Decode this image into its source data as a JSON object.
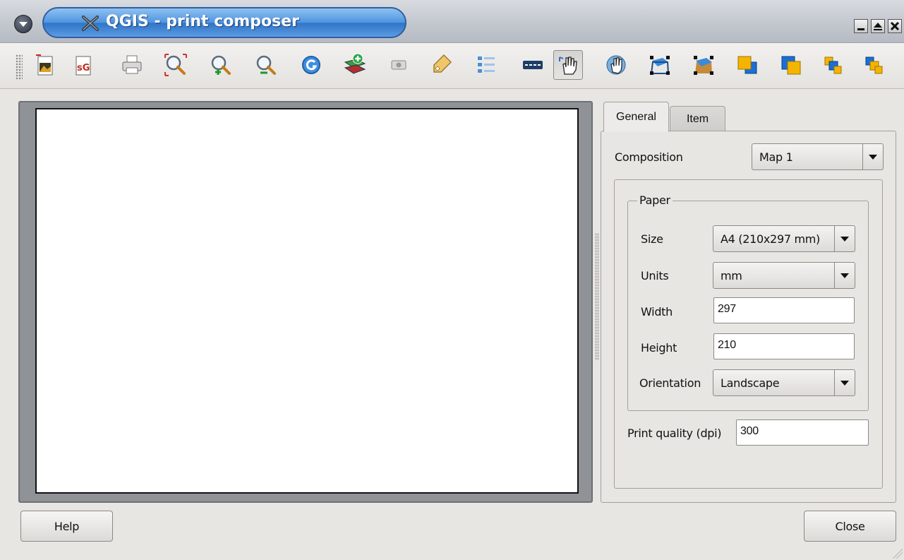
{
  "window": {
    "title": "QGIS - print composer"
  },
  "toolbar": {
    "buttons": [
      {
        "icon": "export-image-icon",
        "active": false
      },
      {
        "icon": "export-svg-icon",
        "active": false
      },
      {
        "icon": "print-icon",
        "active": false
      },
      {
        "icon": "zoom-full-icon",
        "active": false
      },
      {
        "icon": "zoom-in-icon",
        "active": false
      },
      {
        "icon": "zoom-out-icon",
        "active": false
      },
      {
        "icon": "refresh-icon",
        "active": false
      },
      {
        "icon": "add-map-icon",
        "active": false
      },
      {
        "icon": "add-image-icon",
        "active": false
      },
      {
        "icon": "add-label-icon",
        "active": false
      },
      {
        "icon": "add-legend-icon",
        "active": false
      },
      {
        "icon": "add-scalebar-icon",
        "active": false
      },
      {
        "icon": "select-move-icon",
        "active": true
      },
      {
        "icon": "move-content-icon",
        "active": false
      },
      {
        "icon": "group-icon",
        "active": false
      },
      {
        "icon": "ungroup-icon",
        "active": false
      },
      {
        "icon": "raise-icon",
        "active": false
      },
      {
        "icon": "lower-icon",
        "active": false
      },
      {
        "icon": "bring-to-front-icon",
        "active": false
      },
      {
        "icon": "send-to-back-icon",
        "active": false
      }
    ]
  },
  "tabs": {
    "general": "General",
    "item": "Item"
  },
  "general": {
    "composition_label": "Composition",
    "composition_value": "Map 1",
    "paper_legend": "Paper",
    "size_label": "Size",
    "size_value": "A4 (210x297 mm)",
    "units_label": "Units",
    "units_value": "mm",
    "width_label": "Width",
    "width_value": "297",
    "height_label": "Height",
    "height_value": "210",
    "orientation_label": "Orientation",
    "orientation_value": "Landscape",
    "print_quality_label": "Print quality (dpi)",
    "print_quality_value": "300"
  },
  "buttons": {
    "help": "Help",
    "close": "Close"
  },
  "colors": {
    "title_accent": "#4e94e0",
    "canvas_frame": "#8f9398",
    "paper": "#ffffff"
  }
}
